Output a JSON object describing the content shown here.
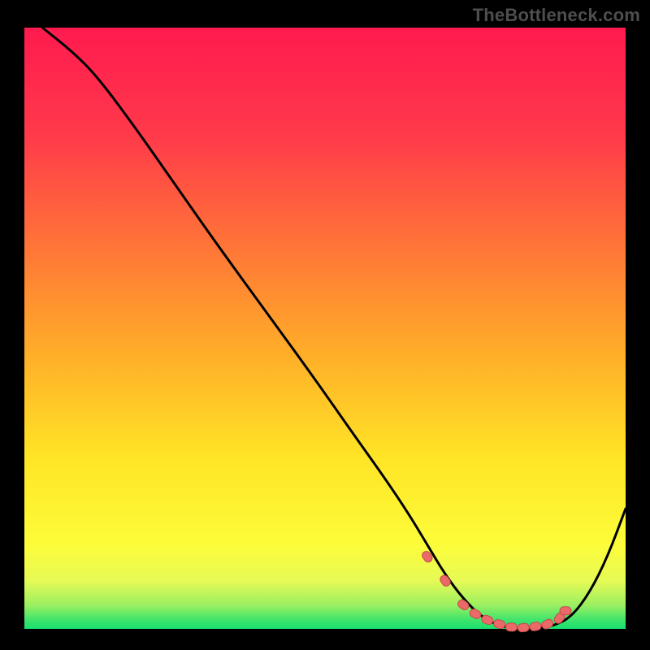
{
  "watermark": "TheBottleneck.com",
  "colors": {
    "red": "#ff1a4f",
    "orange": "#ffa024",
    "yellow": "#fff823",
    "green": "#17e06e",
    "curve": "#000000",
    "marker_fill": "#ea6a6a",
    "marker_stroke": "#c94b4b",
    "frame": "#000000"
  },
  "gradient_zones": [
    {
      "y_percent": 0,
      "band": "red"
    },
    {
      "y_percent": 50,
      "band": "orange"
    },
    {
      "y_percent": 70,
      "band": "yellow"
    },
    {
      "y_percent": 95,
      "band": "green"
    }
  ],
  "chart_data": {
    "type": "line",
    "title": "",
    "xlabel": "",
    "ylabel": "",
    "x_range": [
      0,
      100
    ],
    "y_range": [
      0,
      100
    ],
    "ylim": [
      0,
      100
    ],
    "grid": false,
    "legend": false,
    "series": [
      {
        "name": "bottleneck-curve",
        "x": [
          3,
          8,
          12,
          18,
          25,
          32,
          40,
          48,
          55,
          60,
          64,
          67,
          70,
          73,
          76,
          79,
          82,
          85,
          88,
          91,
          94,
          97,
          100
        ],
        "y": [
          100,
          96,
          92,
          84,
          74,
          64,
          53,
          42,
          32,
          25,
          19,
          14,
          9,
          5,
          2,
          0.5,
          0,
          0,
          0.5,
          2,
          6,
          12,
          20
        ]
      }
    ],
    "markers": {
      "name": "highlight-points",
      "x": [
        67,
        70,
        73,
        75,
        77,
        79,
        81,
        83,
        85,
        87,
        89,
        90
      ],
      "y": [
        12,
        8,
        4,
        2.5,
        1.5,
        0.8,
        0.3,
        0.2,
        0.4,
        0.8,
        1.8,
        3
      ]
    }
  }
}
